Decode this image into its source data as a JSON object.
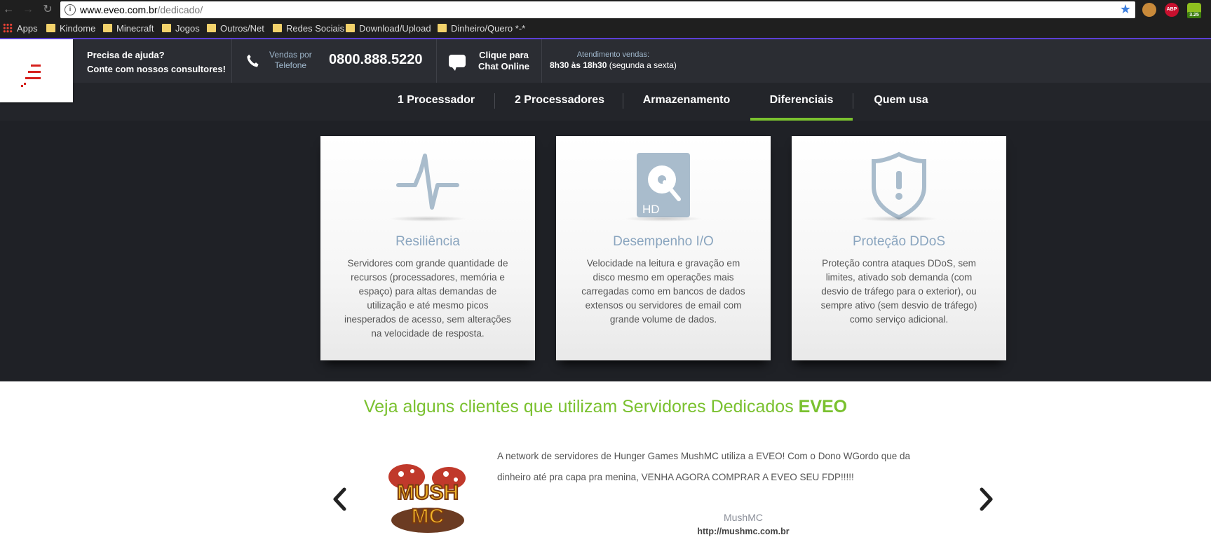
{
  "browser": {
    "url_host": "www.eveo.com.br",
    "url_path": "/dedicado/",
    "extensions": [
      "cookie-icon",
      "abp-icon",
      "android-icon"
    ],
    "abp_label": "ABP",
    "ext_badge": "3.25",
    "bookmarks": [
      {
        "label": "Apps",
        "icon": "apps-grid-icon"
      },
      {
        "label": "Kindome",
        "icon": "folder-icon"
      },
      {
        "label": "Minecraft",
        "icon": "folder-icon"
      },
      {
        "label": "Jogos",
        "icon": "folder-icon"
      },
      {
        "label": "Outros/Net",
        "icon": "folder-icon"
      },
      {
        "label": "Redes Sociais",
        "icon": "folder-icon"
      },
      {
        "label": "Download/Upload",
        "icon": "folder-icon"
      },
      {
        "label": "Dinheiro/Quero *-*",
        "icon": "folder-icon"
      }
    ]
  },
  "header": {
    "help_line1": "Precisa de ajuda?",
    "help_line2": "Conte com nossos consultores!",
    "vendas_line1": "Vendas por",
    "vendas_line2": "Telefone",
    "phone": "0800.888.5220",
    "chat_line1": "Clique para",
    "chat_line2": "Chat Online",
    "atend_line1": "Atendimento vendas:",
    "atend_hours": "8h30 às 18h30",
    "atend_days": "(segunda a sexta)"
  },
  "nav": {
    "items": [
      {
        "label": "1 Processador",
        "active": false
      },
      {
        "label": "2 Processadores",
        "active": false
      },
      {
        "label": "Armazenamento",
        "active": false
      },
      {
        "label": "Diferenciais",
        "active": true
      },
      {
        "label": "Quem usa",
        "active": false
      }
    ],
    "active_color": "#7ac12f"
  },
  "features": [
    {
      "icon": "pulse-icon",
      "title": "Resiliência",
      "text": "Servidores com grande quantidade de recursos (processadores, memória e espaço) para altas demandas de utilização e até mesmo picos inesperados de acesso, sem alterações na velocidade de resposta."
    },
    {
      "icon": "hard-disk-icon",
      "icon_label": "HD",
      "title": "Desempenho I/O",
      "text": "Velocidade na leitura e gravação em disco mesmo em operações mais carregadas como em bancos de dados extensos ou servidores de email com grande volume de dados."
    },
    {
      "icon": "shield-alert-icon",
      "title": "Proteção DDoS",
      "text": "Proteção contra ataques DDoS, sem limites, ativado sob demanda (com desvio de tráfego para o exterior), ou sempre ativo (sem desvio de tráfego) como serviço adicional."
    }
  ],
  "clients": {
    "title_prefix": "Veja alguns clientes que utilizam Servidores Dedicados ",
    "title_brand": "EVEO",
    "testimonial": "A network de servidores de Hunger Games MushMC utiliza a EVEO! Com o Dono WGordo que da dinheiro até pra capa pra menina, VENHA AGORA COMPRAR A EVEO SEU FDP!!!!!",
    "client_name": "MushMC",
    "client_url": "http://mushmc.com.br",
    "logo_text_1": "MUSH",
    "logo_text_2": "MC"
  },
  "colors": {
    "accent_green": "#7ac12f",
    "brand_red": "#d6201c",
    "feature_title": "#8aa5bf"
  }
}
